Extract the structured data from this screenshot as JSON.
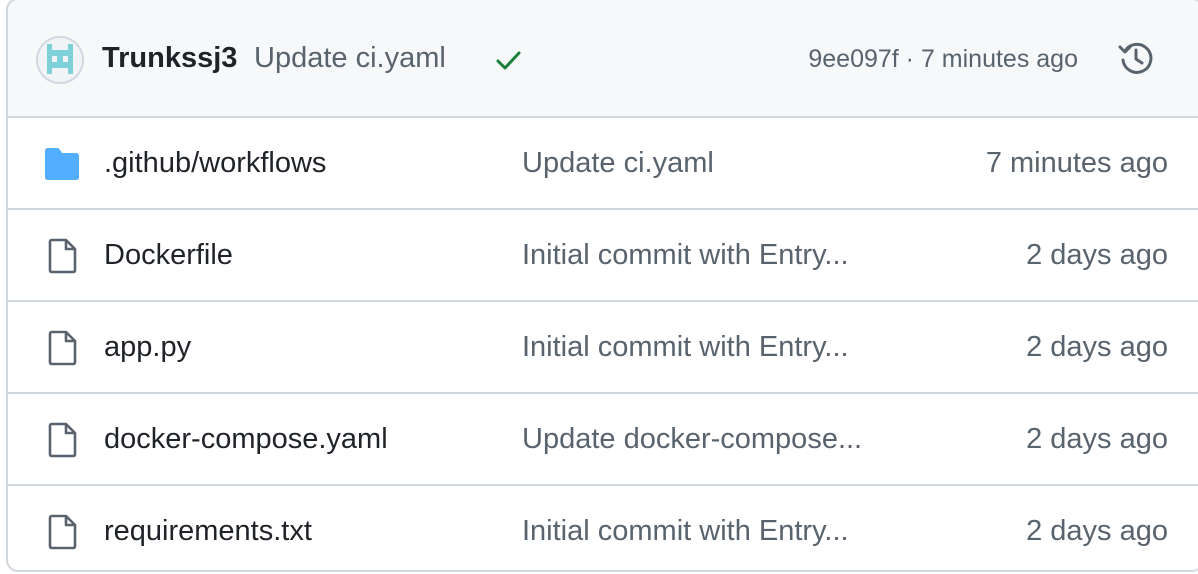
{
  "latest_commit": {
    "author": "Trunkssj3",
    "message": "Update ci.yaml",
    "status": "success",
    "sha_time": "9ee097f · 7 minutes ago",
    "avatar_icon": "identicon-avatar",
    "status_icon": "check-icon",
    "history_icon": "history-icon"
  },
  "files": [
    {
      "name": ".github/workflows",
      "type": "folder",
      "icon": "folder-icon",
      "message": "Update ci.yaml",
      "age": "7 minutes ago"
    },
    {
      "name": "Dockerfile",
      "type": "file",
      "icon": "file-icon",
      "message": "Initial commit with Entry...",
      "age": "2 days ago"
    },
    {
      "name": "app.py",
      "type": "file",
      "icon": "file-icon",
      "message": "Initial commit with Entry...",
      "age": "2 days ago"
    },
    {
      "name": "docker-compose.yaml",
      "type": "file",
      "icon": "file-icon",
      "message": "Update docker-compose...",
      "age": "2 days ago"
    },
    {
      "name": "requirements.txt",
      "type": "file",
      "icon": "file-icon",
      "message": "Initial commit with Entry...",
      "age": "2 days ago"
    }
  ],
  "colors": {
    "folder": "#54aeff",
    "check": "#1a7f37",
    "avatar_teal": "#7fd1d9",
    "border": "#d0d7de",
    "muted_text": "#59636e",
    "text": "#1f2328"
  }
}
